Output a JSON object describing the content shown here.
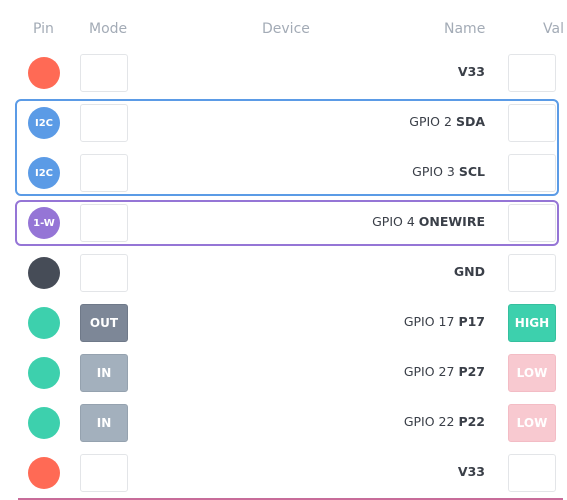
{
  "header": {
    "pin": "Pin",
    "mode": "Mode",
    "device": "Device",
    "name": "Name",
    "value": "Val"
  },
  "colors": {
    "power": "#ff6a55",
    "i2c": "#5b9be6",
    "onewire": "#9575d6",
    "ground": "#464c57",
    "gpio": "#3dd0ad",
    "out_mode": "#7d8797",
    "in_mode": "#a3b0bd",
    "high": "#3dd0ad",
    "low": "#f8c9d0"
  },
  "rows": [
    {
      "pin_label": "",
      "pin_type": "power",
      "mode": "",
      "gpio": "",
      "name": "V33",
      "value": ""
    },
    {
      "pin_label": "I2C",
      "pin_type": "i2c",
      "mode": "",
      "gpio": "GPIO 2",
      "name": "SDA",
      "value": ""
    },
    {
      "pin_label": "I2C",
      "pin_type": "i2c",
      "mode": "",
      "gpio": "GPIO 3",
      "name": "SCL",
      "value": ""
    },
    {
      "pin_label": "1-W",
      "pin_type": "onewire",
      "mode": "",
      "gpio": "GPIO 4",
      "name": "ONEWIRE",
      "value": ""
    },
    {
      "pin_label": "",
      "pin_type": "ground",
      "mode": "",
      "gpio": "",
      "name": "GND",
      "value": ""
    },
    {
      "pin_label": "",
      "pin_type": "gpio",
      "mode": "OUT",
      "gpio": "GPIO 17",
      "name": "P17",
      "value": "HIGH"
    },
    {
      "pin_label": "",
      "pin_type": "gpio",
      "mode": "IN",
      "gpio": "GPIO 27",
      "name": "P27",
      "value": "LOW"
    },
    {
      "pin_label": "",
      "pin_type": "gpio",
      "mode": "IN",
      "gpio": "GPIO 22",
      "name": "P22",
      "value": "LOW"
    },
    {
      "pin_label": "",
      "pin_type": "power",
      "mode": "",
      "gpio": "",
      "name": "V33",
      "value": ""
    }
  ]
}
